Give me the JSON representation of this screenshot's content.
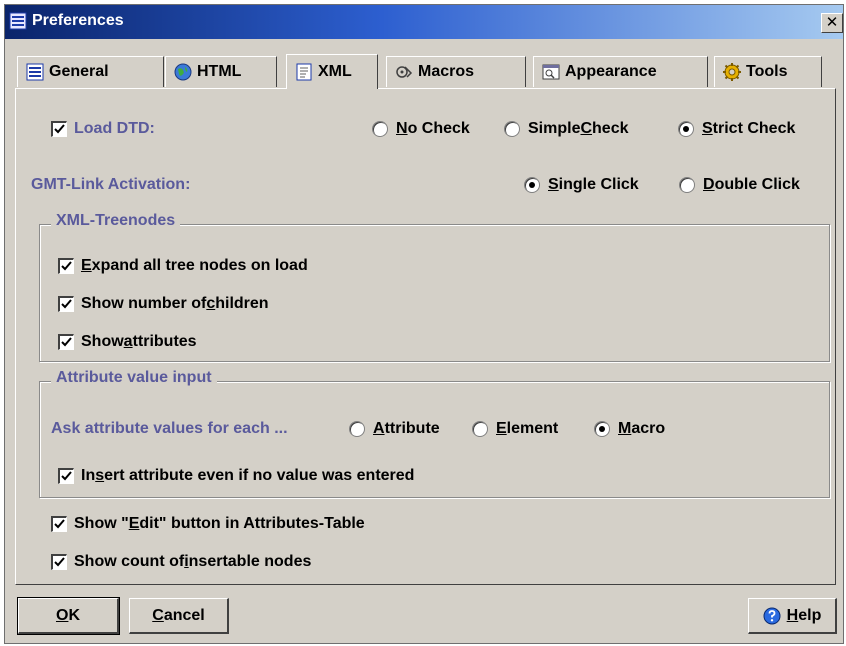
{
  "window": {
    "title": "Preferences",
    "close_glyph": "✕"
  },
  "tabs": [
    {
      "label": "General",
      "icon": "list-icon",
      "active": false
    },
    {
      "label": "HTML",
      "icon": "globe-icon",
      "active": false
    },
    {
      "label": "XML",
      "icon": "document-icon",
      "active": true
    },
    {
      "label": "Macros",
      "icon": "macro-icon",
      "active": false
    },
    {
      "label": "Appearance",
      "icon": "window-icon",
      "active": false
    },
    {
      "label": "Tools",
      "icon": "gear-icon",
      "active": false
    }
  ],
  "xml": {
    "load_dtd": {
      "label": "Load DTD:",
      "checked": true,
      "options": [
        {
          "pre": "",
          "mnemonic": "N",
          "post": "o Check",
          "selected": false
        },
        {
          "pre": "Simple ",
          "mnemonic": "C",
          "post": "heck",
          "selected": false
        },
        {
          "pre": "",
          "mnemonic": "S",
          "post": "trict Check",
          "selected": true
        }
      ]
    },
    "gmt_link": {
      "label": "GMT-Link Activation:",
      "options": [
        {
          "pre": "",
          "mnemonic": "S",
          "post": "ingle Click",
          "selected": true
        },
        {
          "pre": "",
          "mnemonic": "D",
          "post": "ouble Click",
          "selected": false
        }
      ]
    },
    "treenodes": {
      "title": "XML-Treenodes",
      "items": [
        {
          "pre": "",
          "mnemonic": "E",
          "post": "xpand all tree nodes on load",
          "checked": true
        },
        {
          "pre": "Show number of ",
          "mnemonic": "c",
          "post": "hildren",
          "checked": true
        },
        {
          "pre": "Show ",
          "mnemonic": "a",
          "post": "ttributes",
          "checked": true
        }
      ]
    },
    "attr_input": {
      "title": "Attribute value input",
      "ask_label": "Ask attribute values for each ...",
      "options": [
        {
          "pre": "",
          "mnemonic": "A",
          "post": "ttribute",
          "selected": false
        },
        {
          "pre": "",
          "mnemonic": "E",
          "post": "lement",
          "selected": false
        },
        {
          "pre": "",
          "mnemonic": "M",
          "post": "acro",
          "selected": true
        }
      ],
      "insert": {
        "pre": "In",
        "mnemonic": "s",
        "post": "ert attribute even if no value was entered",
        "checked": true
      }
    },
    "show_edit": {
      "pre": "Show \"",
      "mnemonic": "E",
      "post": "dit\" button in Attributes-Table",
      "checked": true
    },
    "show_count": {
      "pre": "Show count of ",
      "mnemonic": "i",
      "post": "nsertable nodes",
      "checked": true
    }
  },
  "buttons": {
    "ok": {
      "mnemonic": "O",
      "post": "K"
    },
    "cancel": {
      "mnemonic": "C",
      "post": "ancel"
    },
    "help": {
      "mnemonic": "H",
      "post": "elp"
    }
  },
  "colors": {
    "title_gradient_start": "#0a246a",
    "title_gradient_end": "#a6caf0",
    "dialog_bg": "#d4d0c8",
    "label_blue": "#5a5a9c"
  }
}
